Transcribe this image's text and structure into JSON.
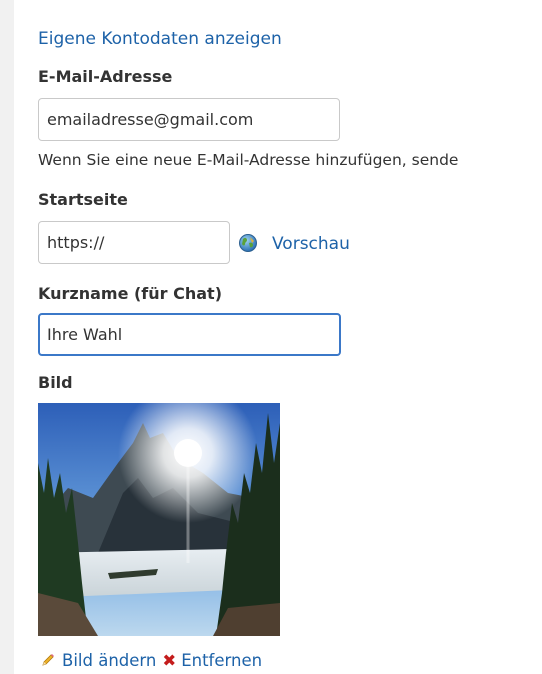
{
  "account": {
    "show_link": "Eigene Kontodaten anzeigen"
  },
  "email": {
    "label": "E-Mail-Adresse",
    "value": "emailadresse@gmail.com",
    "note": "Wenn Sie eine neue E-Mail-Adresse hinzufügen, sende"
  },
  "homepage": {
    "label": "Startseite",
    "value": "https://",
    "preview_icon": "globe-icon",
    "preview_link": "Vorschau"
  },
  "nickname": {
    "label": "Kurzname (für Chat)",
    "value": "Ihre Wahl"
  },
  "picture": {
    "label": "Bild",
    "change_icon": "pencil-icon",
    "change_link": "Bild ändern",
    "remove_icon": "✖",
    "remove_link": "Entfernen"
  },
  "colors": {
    "link": "#1d62a8",
    "focus_border": "#3b78c8",
    "remove_red": "#c41c1c"
  }
}
